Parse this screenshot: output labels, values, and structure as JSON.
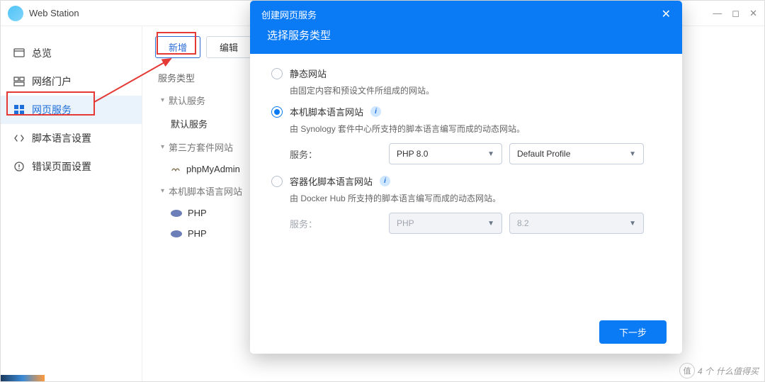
{
  "app": {
    "title": "Web Station"
  },
  "win_controls": {
    "min": "—",
    "max": "◻",
    "close": "✕"
  },
  "sidebar": {
    "items": [
      {
        "label": "总览",
        "icon": "overview-icon"
      },
      {
        "label": "网络门户",
        "icon": "portal-icon"
      },
      {
        "label": "网页服务",
        "icon": "webservice-icon"
      },
      {
        "label": "脚本语言设置",
        "icon": "script-icon"
      },
      {
        "label": "错误页面设置",
        "icon": "error-icon"
      }
    ]
  },
  "toolbar": {
    "add": "新增",
    "edit": "编辑"
  },
  "svc": {
    "header": "服务类型",
    "g1": "默认服务",
    "g1_item": "默认服务",
    "g2": "第三方套件网站",
    "g2_item": "phpMyAdmin",
    "g3": "本机脚本语言网站",
    "g3_item1": "PHP",
    "g3_item2": "PHP"
  },
  "modal": {
    "header": "创建网页服务",
    "title": "选择服务类型",
    "opt1": {
      "title": "静态网站",
      "desc": "由固定内容和预设文件所组成的网站。"
    },
    "opt2": {
      "title": "本机脚本语言网站",
      "desc": "由 Synology 套件中心所支持的脚本语言编写而成的动态网站。",
      "svc_label": "服务：",
      "svc_value": "PHP 8.0",
      "profile_value": "Default Profile"
    },
    "opt3": {
      "title": "容器化脚本语言网站",
      "desc": "由 Docker Hub 所支持的脚本语言编写而成的动态网站。",
      "svc_label": "服务：",
      "svc_value": "PHP",
      "ver_value": "8.2"
    },
    "next": "下一步"
  },
  "watermark": {
    "count": "4 个",
    "text": "什么值得买",
    "glyph": "值"
  }
}
